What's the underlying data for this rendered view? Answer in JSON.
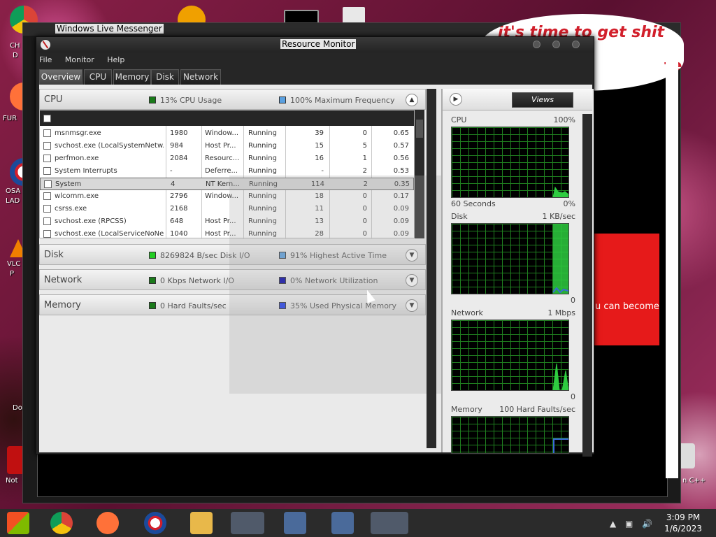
{
  "desktop": {
    "labels": [
      "CH",
      "D",
      "FUR",
      "OSA",
      "LAD",
      "VLC",
      "P",
      "Do",
      "Not",
      "n C++"
    ]
  },
  "messenger": {
    "title": "Windows Live Messenger",
    "bubble_text": "it's time to get shit",
    "bubble_text2": "te",
    "red_box_text": "u can become"
  },
  "resmon": {
    "title": "Resource Monitor",
    "menu": [
      "File",
      "Monitor",
      "Help"
    ],
    "tabs": [
      "Overview",
      "CPU",
      "Memory",
      "Disk",
      "Network"
    ],
    "active_tab": "Overview",
    "cpu": {
      "name": "CPU",
      "usage": "13% CPU Usage",
      "freq": "100% Maximum Frequency",
      "rows": [
        {
          "image": "msnmsgr.exe",
          "pid": "1980",
          "desc": "Window...",
          "status": "Running",
          "threads": "39",
          "cpu": "0",
          "avg": "0.65"
        },
        {
          "image": "svchost.exe (LocalSystemNetw...",
          "pid": "984",
          "desc": "Host Pr...",
          "status": "Running",
          "threads": "15",
          "cpu": "5",
          "avg": "0.57"
        },
        {
          "image": "perfmon.exe",
          "pid": "2084",
          "desc": "Resourc...",
          "status": "Running",
          "threads": "16",
          "cpu": "1",
          "avg": "0.56"
        },
        {
          "image": "System Interrupts",
          "pid": "-",
          "desc": "Deferre...",
          "status": "Running",
          "threads": "-",
          "cpu": "2",
          "avg": "0.53"
        },
        {
          "image": "System",
          "pid": "4",
          "desc": "NT Kern...",
          "status": "Running",
          "threads": "114",
          "cpu": "2",
          "avg": "0.35"
        },
        {
          "image": "wlcomm.exe",
          "pid": "2796",
          "desc": "Window...",
          "status": "Running",
          "threads": "18",
          "cpu": "0",
          "avg": "0.17"
        },
        {
          "image": "csrss.exe",
          "pid": "2168",
          "desc": "",
          "status": "Running",
          "threads": "11",
          "cpu": "0",
          "avg": "0.09"
        },
        {
          "image": "svchost.exe (RPCSS)",
          "pid": "648",
          "desc": "Host Pr...",
          "status": "Running",
          "threads": "13",
          "cpu": "0",
          "avg": "0.09"
        },
        {
          "image": "svchost.exe (LocalServiceNoNe...",
          "pid": "1040",
          "desc": "Host Pr...",
          "status": "Running",
          "threads": "28",
          "cpu": "0",
          "avg": "0.09"
        }
      ]
    },
    "disk": {
      "name": "Disk",
      "io": "8269824 B/sec Disk I/O",
      "active": "91% Highest Active Time"
    },
    "network": {
      "name": "Network",
      "io": "0 Kbps Network I/O",
      "util": "0% Network Utilization"
    },
    "memory": {
      "name": "Memory",
      "faults": "0 Hard Faults/sec",
      "used": "35% Used Physical Memory"
    },
    "colors": {
      "cpu_usage": "#1a7a1a",
      "cpu_freq": "#5aa0e0",
      "disk_io": "#22cc22",
      "disk_active": "#5aa0e0",
      "net_io": "#1a7a1a",
      "net_util": "#0000aa",
      "mem_faults": "#1a7a1a",
      "mem_used": "#1a3aee"
    },
    "views": {
      "button": "Views",
      "graphs": [
        {
          "title": "CPU",
          "max": "100%",
          "foot_left": "60 Seconds",
          "foot_right": "0%"
        },
        {
          "title": "Disk",
          "max": "1 KB/sec",
          "foot_right": "0"
        },
        {
          "title": "Network",
          "max": "1 Mbps",
          "foot_right": "0"
        },
        {
          "title": "Memory",
          "max": "100 Hard Faults/sec"
        }
      ]
    }
  },
  "taskbar": {
    "time": "3:09 PM",
    "date": "1/6/2023"
  }
}
